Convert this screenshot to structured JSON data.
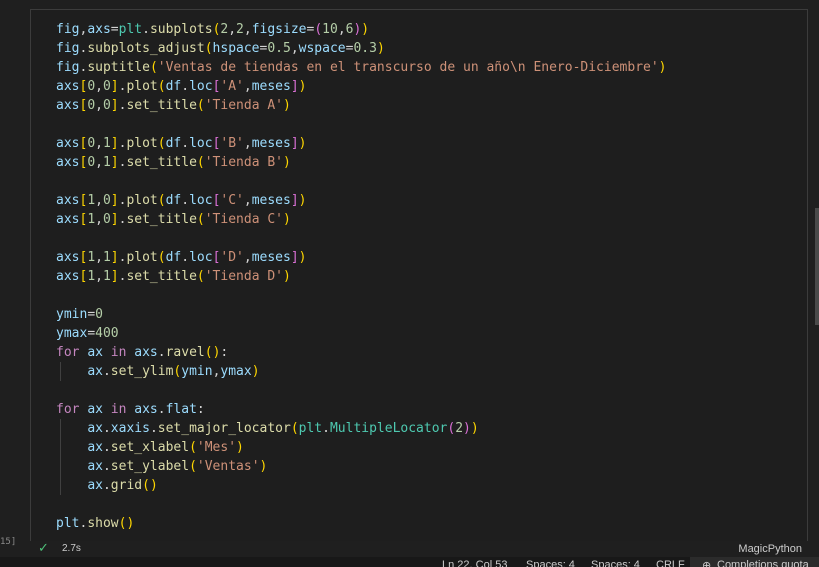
{
  "cell": {
    "execution_count": "15]",
    "run_time": "2.7s",
    "language": "MagicPython"
  },
  "statusbar": {
    "position": "Ln 22, Col 53",
    "spaces1": "Spaces: 4",
    "spaces2": "Spaces: 4",
    "eol": "CRLF",
    "completions": "Completions quota"
  },
  "code": {
    "l1": [
      "fig",
      "axs",
      "=",
      "plt",
      ".",
      "subplots",
      "(",
      "2",
      ",",
      "2",
      ",",
      "figsize",
      "=",
      "(",
      "10",
      ",",
      "6",
      ")",
      ")"
    ],
    "l2": [
      "fig",
      ".",
      "subplots_adjust",
      "(",
      "hspace",
      "=",
      "0.5",
      ",",
      "wspace",
      "=",
      "0.3",
      ")"
    ],
    "l3": [
      "fig",
      ".",
      "suptitle",
      "(",
      "'Ventas de tiendas en el transcurso de un año\\n Enero-Diciembre'",
      ")"
    ],
    "l4": [
      "axs",
      "[",
      "0",
      ",",
      "0",
      "]",
      ".",
      "plot",
      "(",
      "df",
      ".",
      "loc",
      "[",
      "'A'",
      ",",
      "meses",
      "]",
      ")"
    ],
    "l5": [
      "axs",
      "[",
      "0",
      ",",
      "0",
      "]",
      ".",
      "set_title",
      "(",
      "'Tienda A'",
      ")"
    ],
    "l7": [
      "axs",
      "[",
      "0",
      ",",
      "1",
      "]",
      ".",
      "plot",
      "(",
      "df",
      ".",
      "loc",
      "[",
      "'B'",
      ",",
      "meses",
      "]",
      ")"
    ],
    "l8": [
      "axs",
      "[",
      "0",
      ",",
      "1",
      "]",
      ".",
      "set_title",
      "(",
      "'Tienda B'",
      ")"
    ],
    "l10": [
      "axs",
      "[",
      "1",
      ",",
      "0",
      "]",
      ".",
      "plot",
      "(",
      "df",
      ".",
      "loc",
      "[",
      "'C'",
      ",",
      "meses",
      "]",
      ")"
    ],
    "l11": [
      "axs",
      "[",
      "1",
      ",",
      "0",
      "]",
      ".",
      "set_title",
      "(",
      "'Tienda C'",
      ")"
    ],
    "l13": [
      "axs",
      "[",
      "1",
      ",",
      "1",
      "]",
      ".",
      "plot",
      "(",
      "df",
      ".",
      "loc",
      "[",
      "'D'",
      ",",
      "meses",
      "]",
      ")"
    ],
    "l14": [
      "axs",
      "[",
      "1",
      ",",
      "1",
      "]",
      ".",
      "set_title",
      "(",
      "'Tienda D'",
      ")"
    ],
    "l16": [
      "ymin",
      "=",
      "0"
    ],
    "l17": [
      "ymax",
      "=",
      "400"
    ],
    "l18": [
      "for",
      " ",
      "ax",
      " ",
      "in",
      " ",
      "axs",
      ".",
      "ravel",
      "(",
      ")",
      ":"
    ],
    "l19": [
      "    ",
      "ax",
      ".",
      "set_ylim",
      "(",
      "ymin",
      ",",
      "ymax",
      ")"
    ],
    "l21": [
      "for",
      " ",
      "ax",
      " ",
      "in",
      " ",
      "axs",
      ".",
      "flat",
      ":"
    ],
    "l22": [
      "    ",
      "ax",
      ".",
      "xaxis",
      ".",
      "set_major_locator",
      "(",
      "plt",
      ".",
      "MultipleLocator",
      "(",
      "2",
      ")",
      ")"
    ],
    "l23": [
      "    ",
      "ax",
      ".",
      "set_xlabel",
      "(",
      "'Mes'",
      ")"
    ],
    "l24": [
      "    ",
      "ax",
      ".",
      "set_ylabel",
      "(",
      "'Ventas'",
      ")"
    ],
    "l25": [
      "    ",
      "ax",
      ".",
      "grid",
      "(",
      ")"
    ],
    "l27": [
      "plt",
      ".",
      "show",
      "(",
      ")"
    ]
  }
}
